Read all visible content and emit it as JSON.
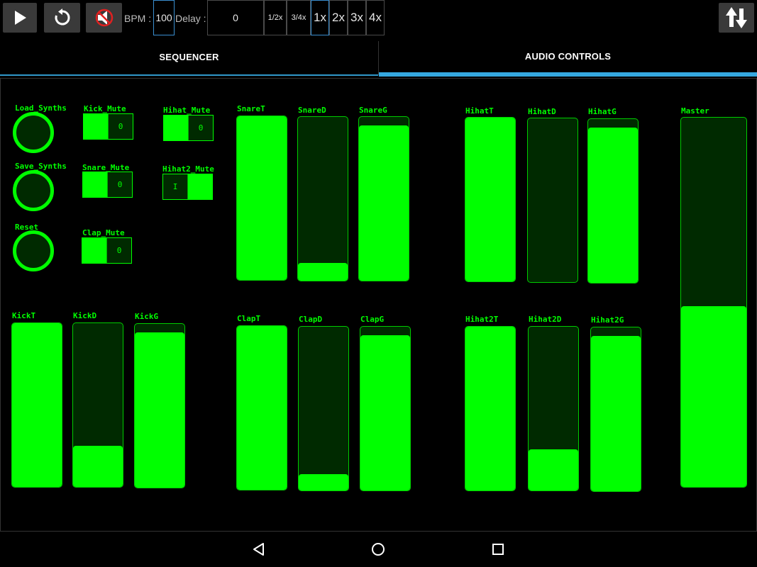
{
  "colors": {
    "accent": "#00ff00",
    "tab_indicator": "#35a8e0",
    "toolbar_button": "#3a3a3a"
  },
  "toolbar": {
    "play_icon": "play-icon",
    "reset_icon": "replay-icon",
    "mute_icon": "mute-icon",
    "bpm_label": "BPM :",
    "bpm_value": "100",
    "delay_label": "Delay :",
    "delay_value": "0",
    "speeds": [
      "1/2x",
      "3/4x",
      "1x",
      "2x",
      "3x",
      "4x"
    ],
    "selected_speed": "1x",
    "swap_icon": "swap-vertical-icon"
  },
  "tabs": [
    {
      "label": "SEQUENCER",
      "active": false
    },
    {
      "label": "AUDIO CONTROLS",
      "active": true
    }
  ],
  "buttons": {
    "load": "Load_Synths",
    "save": "Save_Synths",
    "reset": "Reset"
  },
  "mutes": {
    "kick": {
      "label": "Kick_Mute",
      "state": "0"
    },
    "snare": {
      "label": "Snare_Mute",
      "state": "0"
    },
    "clap": {
      "label": "Clap_Mute",
      "state": "0"
    },
    "hihat": {
      "label": "Hihat_Mute",
      "state": "0"
    },
    "hihat2": {
      "label": "Hihat2_Mute",
      "state": "I"
    }
  },
  "sliders": {
    "KickT": {
      "label": "KickT",
      "level": 1.0
    },
    "KickD": {
      "label": "KickD",
      "level": 0.25
    },
    "KickG": {
      "label": "KickG",
      "level": 0.95
    },
    "SnareT": {
      "label": "SnareT",
      "level": 1.0
    },
    "SnareD": {
      "label": "SnareD",
      "level": 0.11
    },
    "SnareG": {
      "label": "SnareG",
      "level": 0.95
    },
    "ClapT": {
      "label": "ClapT",
      "level": 1.0
    },
    "ClapD": {
      "label": "ClapD",
      "level": 0.1
    },
    "ClapG": {
      "label": "ClapG",
      "level": 0.95
    },
    "HihatT": {
      "label": "HihatT",
      "level": 1.0
    },
    "HihatD": {
      "label": "HihatD",
      "level": 0.0
    },
    "HihatG": {
      "label": "HihatG",
      "level": 0.95
    },
    "Hihat2T": {
      "label": "Hihat2T",
      "level": 1.0
    },
    "Hihat2D": {
      "label": "Hihat2D",
      "level": 0.25
    },
    "Hihat2G": {
      "label": "Hihat2G",
      "level": 0.95
    },
    "Master": {
      "label": "Master",
      "level": 0.49
    }
  },
  "navbar": {
    "back": "back-icon",
    "home": "home-icon",
    "recents": "recents-icon"
  }
}
